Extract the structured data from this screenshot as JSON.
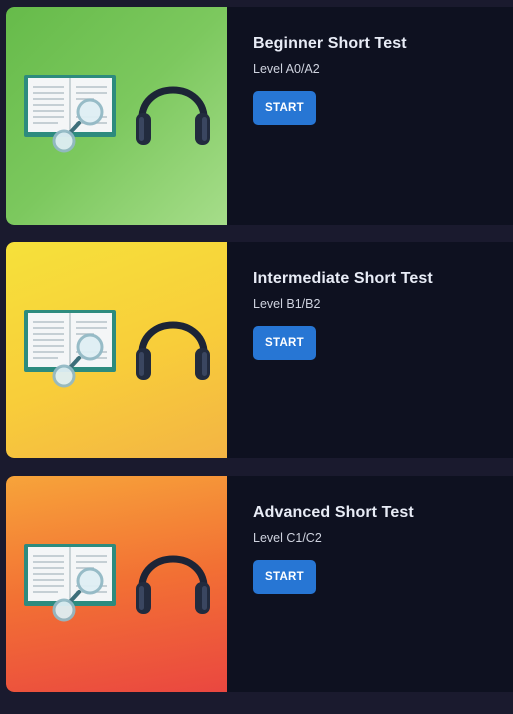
{
  "tests": [
    {
      "title": "Beginner Short Test",
      "level": "Level A0/A2",
      "button": "START",
      "image_icons": [
        "book-magnifier-icon",
        "headphones-icon"
      ],
      "thumb_color": "#7cc85e"
    },
    {
      "title": "Intermediate Short Test",
      "level": "Level B1/B2",
      "button": "START",
      "image_icons": [
        "book-magnifier-icon",
        "headphones-icon"
      ],
      "thumb_color": "#f8cd3a"
    },
    {
      "title": "Advanced Short Test",
      "level": "Level C1/C2",
      "button": "START",
      "image_icons": [
        "book-magnifier-icon",
        "headphones-icon"
      ],
      "thumb_color": "#f27034"
    }
  ],
  "colors": {
    "background": "#1a1a2e",
    "card": "#0e1120",
    "button": "#2776d4"
  }
}
